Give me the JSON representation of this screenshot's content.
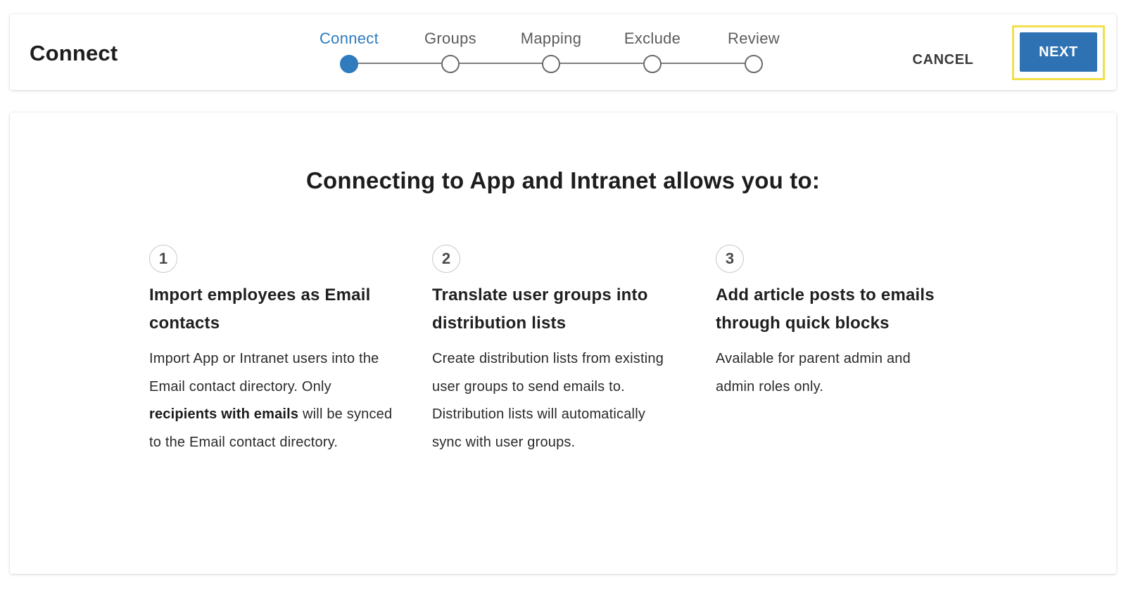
{
  "header": {
    "title": "Connect",
    "stepper": {
      "steps": [
        {
          "label": "Connect",
          "active": true
        },
        {
          "label": "Groups",
          "active": false
        },
        {
          "label": "Mapping",
          "active": false
        },
        {
          "label": "Exclude",
          "active": false
        },
        {
          "label": "Review",
          "active": false
        }
      ]
    },
    "actions": {
      "cancel_label": "CANCEL",
      "next_label": "NEXT"
    }
  },
  "content": {
    "heading": "Connecting to App and Intranet allows you to:",
    "features": [
      {
        "number": "1",
        "title": "Import employees as Email contacts",
        "description": {
          "before": "Import App or Intranet users into the Email contact directory. Only ",
          "bold": "recipients with emails",
          "after": " will be synced to the Email contact directory."
        }
      },
      {
        "number": "2",
        "title": "Translate user groups into distribution lists",
        "description": {
          "before": "Create distribution lists from existing user groups to send emails to. Distribution lists will automatically sync with user groups.",
          "bold": "",
          "after": ""
        }
      },
      {
        "number": "3",
        "title": "Add article posts to emails through quick blocks",
        "description": {
          "before": "Available for parent admin and admin roles only.",
          "bold": "",
          "after": ""
        }
      }
    ]
  },
  "colors": {
    "accent": "#2f7bbd",
    "primary_button": "#2f72b3",
    "highlight": "#f2e04b"
  }
}
